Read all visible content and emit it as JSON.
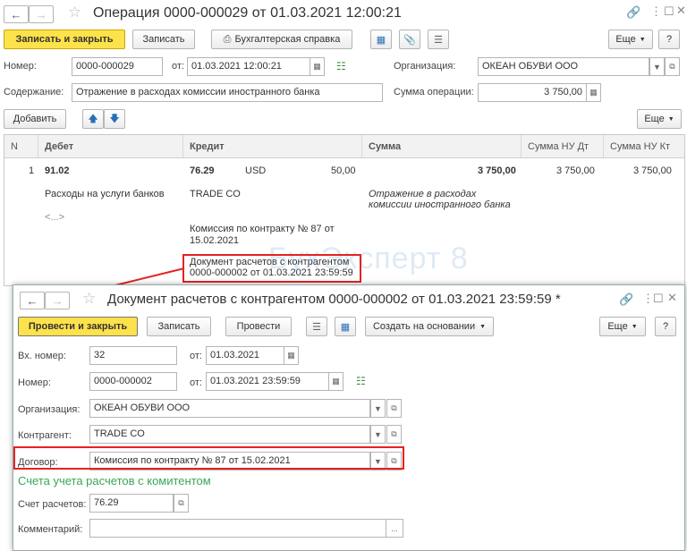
{
  "main": {
    "title": "Операция 0000-000029 от 01.03.2021 12:00:21",
    "toolbar": {
      "post_close": "Записать и закрыть",
      "save": "Записать",
      "report": "Бухгалтерская справка",
      "more": "Еще",
      "help": "?"
    },
    "number_label": "Номер:",
    "number_value": "0000-000029",
    "date_label": "от:",
    "date_value": "01.03.2021 12:00:21",
    "org_label": "Организация:",
    "org_value": "ОКЕАН ОБУВИ ООО",
    "content_label": "Содержание:",
    "content_value": "Отражение в расходах комиссии иностранного банка",
    "sum_label": "Сумма операции:",
    "sum_value": "3 750,00",
    "add_button": "Добавить",
    "more2": "Еще",
    "table": {
      "headers": [
        "N",
        "Дебет",
        "Кредит",
        "Сумма",
        "Сумма НУ Дт",
        "Сумма НУ Кт"
      ],
      "row": {
        "n": "1",
        "debit": "91.02",
        "credit": "76.29",
        "currency": "USD",
        "currency_sum": "50,00",
        "sum": "3 750,00",
        "nu_dt": "3 750,00",
        "nu_kt": "3 750,00",
        "debit_sub1": "Расходы на услуги банков",
        "debit_sub2": "<...>",
        "credit_sub1": "TRADE CO",
        "credit_sub2a": "Комиссия по контракту № 87 от",
        "credit_sub2b": "15.02.2021",
        "credit_sub3a": "Документ расчетов с контрагентом",
        "credit_sub3b": "0000-000002 от 01.03.2021 23:59:59",
        "comment_a": "Отражение в расходах",
        "comment_b": "комиссии иностранного банка"
      }
    },
    "watermark": "БухЭксперт 8"
  },
  "dialog": {
    "title": "Документ расчетов с контрагентом 0000-000002 от 01.03.2021 23:59:59",
    "modified_mark": "*",
    "toolbar": {
      "post_close": "Провести и закрыть",
      "save": "Записать",
      "post": "Провести",
      "create_based": "Создать на основании",
      "more": "Еще",
      "help": "?"
    },
    "in_number_label": "Вх. номер:",
    "in_number_value": "32",
    "in_date_label": "от:",
    "in_date_value": "01.03.2021",
    "number_label": "Номер:",
    "number_value": "0000-000002",
    "date_label": "от:",
    "date_value": "01.03.2021 23:59:59",
    "org_label": "Организация:",
    "org_value": "ОКЕАН ОБУВИ ООО",
    "counterparty_label": "Контрагент:",
    "counterparty_value": "TRADE CO",
    "contract_label": "Договор:",
    "contract_value": "Комиссия по контракту № 87 от 15.02.2021",
    "section_title": "Счета учета расчетов с комитентом",
    "account_label": "Счет расчетов:",
    "account_value": "76.29",
    "comment_label": "Комментарий:",
    "comment_value": "",
    "comment_btn": "..."
  },
  "colors": {
    "accent_yellow": "#fde24b",
    "highlight_red": "#e52222",
    "section_green": "#3aa55a"
  }
}
